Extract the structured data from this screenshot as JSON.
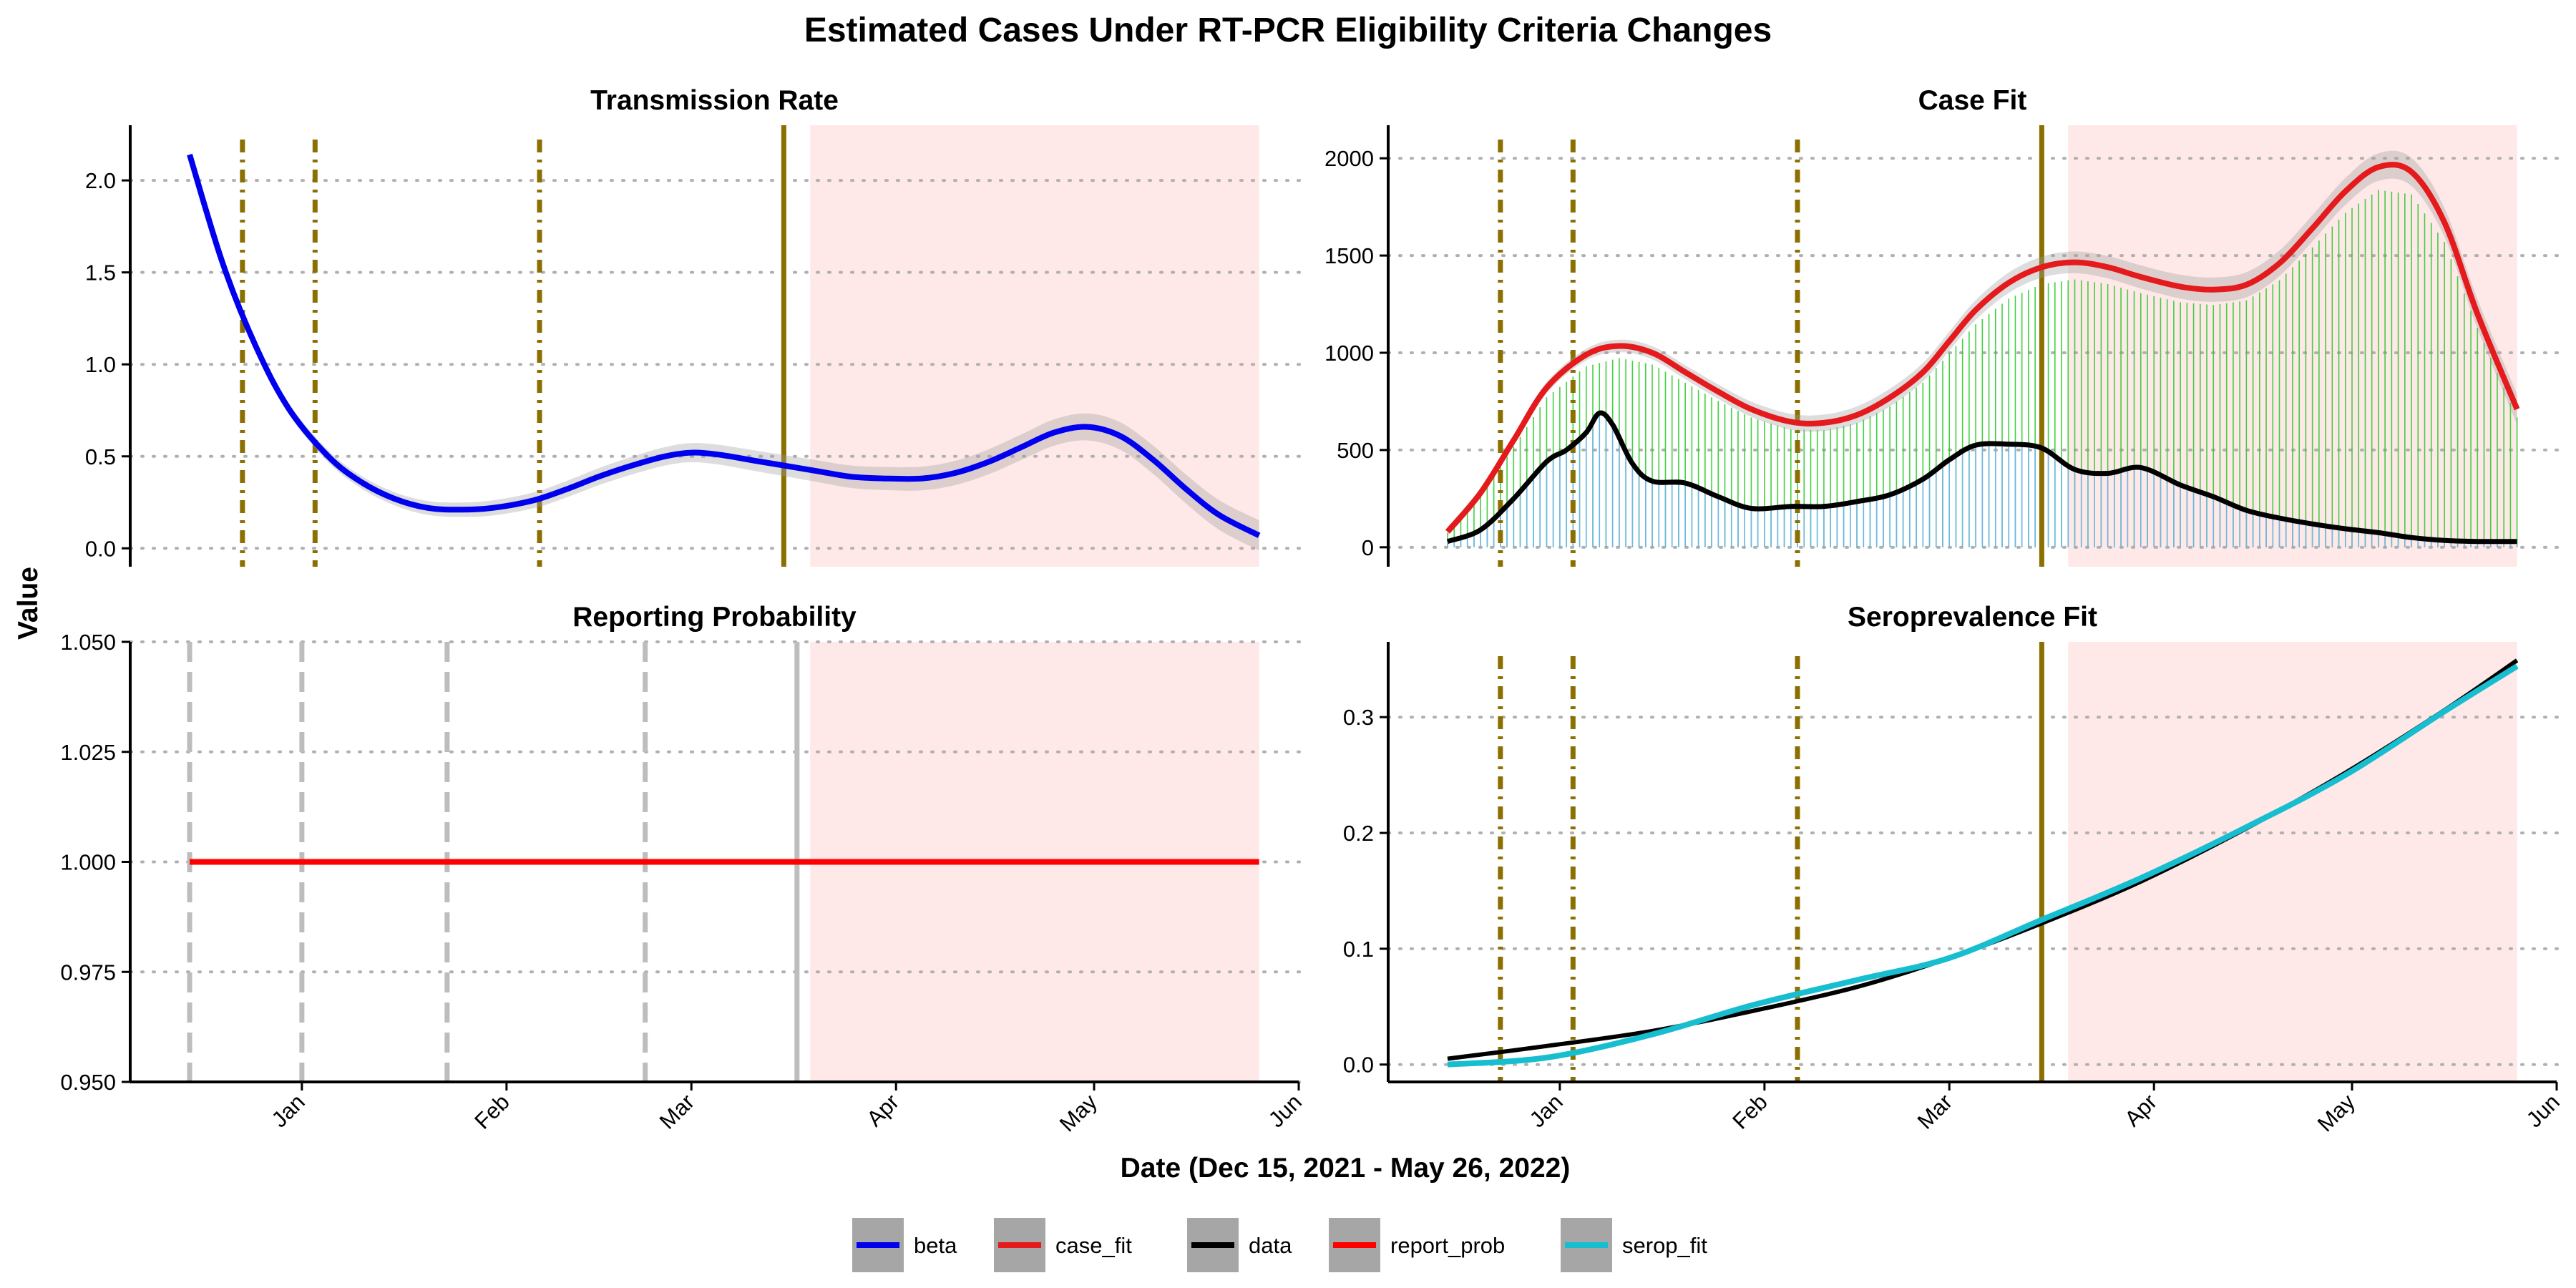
{
  "chart_data": {
    "type": "line",
    "title": "Estimated Cases Under RT-PCR Eligibility Criteria Changes",
    "xlabel": "Date (Dec 15, 2021 - May 26, 2022)",
    "ylabel": "Value",
    "x_ticks": [
      {
        "label": "Jan",
        "date": "2022-01-01"
      },
      {
        "label": "Feb",
        "date": "2022-02-01"
      },
      {
        "label": "Mar",
        "date": "2022-03-01"
      },
      {
        "label": "Apr",
        "date": "2022-04-01"
      },
      {
        "label": "May",
        "date": "2022-05-01"
      },
      {
        "label": "Jun",
        "date": "2022-06-01"
      }
    ],
    "xlim": [
      "2021-12-06",
      "2022-06-01"
    ],
    "shaded_region": {
      "start": "2022-03-19",
      "end": "2022-05-26",
      "color": "#ffe8e8"
    },
    "legend": {
      "placement": "bottom",
      "items": [
        {
          "label": "beta",
          "color": "#0000ee"
        },
        {
          "label": "case_fit",
          "color": "#e41a1c"
        },
        {
          "label": "data",
          "color": "#000000"
        },
        {
          "label": "report_prob",
          "color": "#ff0000"
        },
        {
          "label": "serop_fit",
          "color": "#17becf"
        }
      ]
    },
    "panels": [
      {
        "title": "Transmission Rate",
        "ylim": [
          -0.1,
          2.3
        ],
        "yticks": [
          0.0,
          0.5,
          1.0,
          1.5,
          2.0
        ],
        "ytick_labels": [
          "0.0",
          "0.5",
          "1.0",
          "1.5",
          "2.0"
        ],
        "event_lines": [
          "2021-12-23",
          "2022-01-03",
          "2022-02-06"
        ],
        "key_line": "2022-03-15",
        "series": [
          {
            "name": "beta",
            "color": "#0000ee",
            "ribbon": true,
            "x": [
              "2021-12-15",
              "2021-12-20",
              "2021-12-25",
              "2021-12-30",
              "2022-01-05",
              "2022-01-10",
              "2022-01-15",
              "2022-01-20",
              "2022-01-25",
              "2022-01-30",
              "2022-02-05",
              "2022-02-10",
              "2022-02-15",
              "2022-02-20",
              "2022-02-25",
              "2022-03-01",
              "2022-03-05",
              "2022-03-10",
              "2022-03-15",
              "2022-03-20",
              "2022-03-25",
              "2022-03-30",
              "2022-04-05",
              "2022-04-10",
              "2022-04-15",
              "2022-04-20",
              "2022-04-25",
              "2022-04-30",
              "2022-05-05",
              "2022-05-10",
              "2022-05-15",
              "2022-05-20",
              "2022-05-26"
            ],
            "y": [
              2.14,
              1.55,
              1.1,
              0.76,
              0.5,
              0.36,
              0.27,
              0.22,
              0.21,
              0.22,
              0.26,
              0.32,
              0.39,
              0.45,
              0.5,
              0.52,
              0.51,
              0.48,
              0.45,
              0.42,
              0.39,
              0.38,
              0.38,
              0.41,
              0.47,
              0.55,
              0.63,
              0.66,
              0.61,
              0.48,
              0.32,
              0.18,
              0.07
            ]
          }
        ]
      },
      {
        "title": "Case Fit",
        "ylim": [
          -100,
          2170
        ],
        "yticks": [
          0,
          500,
          1000,
          1500,
          2000
        ],
        "ytick_labels": [
          "0",
          "500",
          "1000",
          "1500",
          "2000"
        ],
        "event_lines": [
          "2021-12-23",
          "2022-01-03",
          "2022-02-06"
        ],
        "key_line": "2022-03-15",
        "series": [
          {
            "name": "case_fit",
            "color": "#e41a1c",
            "ribbon": true,
            "x": [
              "2021-12-15",
              "2021-12-20",
              "2021-12-25",
              "2021-12-30",
              "2022-01-05",
              "2022-01-10",
              "2022-01-15",
              "2022-01-20",
              "2022-01-25",
              "2022-01-30",
              "2022-02-05",
              "2022-02-10",
              "2022-02-15",
              "2022-02-20",
              "2022-02-25",
              "2022-03-01",
              "2022-03-05",
              "2022-03-10",
              "2022-03-15",
              "2022-03-20",
              "2022-03-25",
              "2022-03-30",
              "2022-04-05",
              "2022-04-10",
              "2022-04-15",
              "2022-04-20",
              "2022-04-25",
              "2022-04-30",
              "2022-05-05",
              "2022-05-10",
              "2022-05-15",
              "2022-05-20",
              "2022-05-26"
            ],
            "y": [
              80,
              280,
              550,
              820,
              990,
              1035,
              1000,
              900,
              800,
              710,
              645,
              640,
              680,
              770,
              900,
              1060,
              1220,
              1360,
              1440,
              1465,
              1440,
              1390,
              1340,
              1325,
              1350,
              1460,
              1640,
              1830,
              1955,
              1930,
              1670,
              1200,
              710
            ]
          },
          {
            "name": "data",
            "color": "#000000",
            "x": [
              "2021-12-15",
              "2021-12-20",
              "2021-12-25",
              "2021-12-30",
              "2022-01-02",
              "2022-01-05",
              "2022-01-07",
              "2022-01-09",
              "2022-01-12",
              "2022-01-15",
              "2022-01-20",
              "2022-01-25",
              "2022-01-30",
              "2022-02-05",
              "2022-02-10",
              "2022-02-15",
              "2022-02-20",
              "2022-02-25",
              "2022-03-01",
              "2022-03-05",
              "2022-03-10",
              "2022-03-15",
              "2022-03-20",
              "2022-03-25",
              "2022-03-30",
              "2022-04-05",
              "2022-04-10",
              "2022-04-15",
              "2022-04-20",
              "2022-04-25",
              "2022-04-30",
              "2022-05-05",
              "2022-05-10",
              "2022-05-15",
              "2022-05-20",
              "2022-05-26"
            ],
            "y": [
              30,
              90,
              250,
              440,
              500,
              590,
              690,
              630,
              430,
              340,
              330,
              260,
              200,
              210,
              210,
              235,
              270,
              350,
              450,
              525,
              530,
              510,
              400,
              380,
              410,
              320,
              260,
              190,
              150,
              120,
              95,
              75,
              50,
              35,
              30,
              30
            ]
          }
        ],
        "bars": {
          "green_color": "#2ecc2e",
          "blue_color": "#6fb6e6"
        }
      },
      {
        "title": "Reporting Probability",
        "ylim": [
          0.95,
          1.05
        ],
        "yticks": [
          0.95,
          0.975,
          1.0,
          1.025,
          1.05
        ],
        "ytick_labels": [
          "0.950",
          "0.975",
          "1.000",
          "1.025",
          "1.050"
        ],
        "gray_dashed_lines": [
          "2021-12-15",
          "2022-01-01",
          "2022-01-23",
          "2022-02-22"
        ],
        "gray_solid_line": "2022-03-17",
        "series": [
          {
            "name": "report_prob",
            "color": "#ff0000",
            "x": [
              "2021-12-15",
              "2022-05-26"
            ],
            "y": [
              1.0,
              1.0
            ]
          }
        ]
      },
      {
        "title": "Seroprevalence Fit",
        "ylim": [
          -0.015,
          0.365
        ],
        "yticks": [
          0.0,
          0.1,
          0.2,
          0.3
        ],
        "ytick_labels": [
          "0.0",
          "0.1",
          "0.2",
          "0.3"
        ],
        "event_lines": [
          "2021-12-23",
          "2022-01-03",
          "2022-02-06"
        ],
        "key_line": "2022-03-15",
        "series": [
          {
            "name": "data",
            "color": "#000000",
            "x": [
              "2021-12-15",
              "2021-12-30",
              "2022-01-15",
              "2022-01-30",
              "2022-02-15",
              "2022-03-01",
              "2022-03-15",
              "2022-03-30",
              "2022-04-15",
              "2022-04-30",
              "2022-05-15",
              "2022-05-26"
            ],
            "y": [
              0.005,
              0.016,
              0.029,
              0.046,
              0.067,
              0.092,
              0.122,
              0.158,
              0.204,
              0.252,
              0.306,
              0.349
            ]
          },
          {
            "name": "serop_fit",
            "color": "#17becf",
            "x": [
              "2021-12-15",
              "2021-12-30",
              "2022-01-15",
              "2022-01-30",
              "2022-02-15",
              "2022-03-01",
              "2022-03-15",
              "2022-03-30",
              "2022-04-15",
              "2022-04-30",
              "2022-05-15",
              "2022-05-26"
            ],
            "y": [
              0.0,
              0.006,
              0.026,
              0.051,
              0.073,
              0.092,
              0.125,
              0.161,
              0.205,
              0.25,
              0.305,
              0.344
            ]
          }
        ]
      }
    ]
  }
}
